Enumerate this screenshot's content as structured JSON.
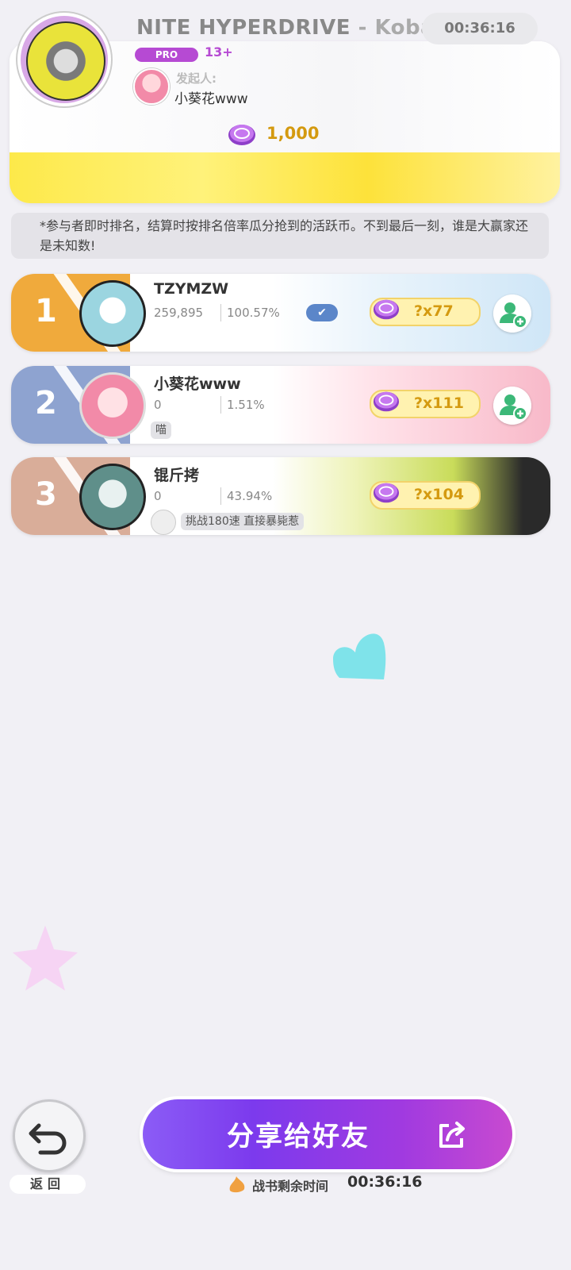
{
  "song": {
    "title": "NITE HYPERDRIVE",
    "artist": "Kobary",
    "separator": " - ",
    "timer": "00:36:16",
    "difficulty": "PRO",
    "level": "13+",
    "host_label": "发起人:",
    "host_name": "小葵花www",
    "prize": "1,000"
  },
  "notice": "*参与者即时排名，结算时按排名倍率瓜分抢到的活跃币。不到最后一刻，谁是大赢家还是未知数!",
  "players": [
    {
      "rank": "1",
      "name": "TZYMZW",
      "score": "259,895",
      "accuracy": "100.57%",
      "reward": "?x77",
      "tag": "",
      "color": "#f0aa3c"
    },
    {
      "rank": "2",
      "name": "小葵花www",
      "score": "0",
      "accuracy": "1.51%",
      "reward": "?x111",
      "tag": "喵",
      "color": "#8ea3d0"
    },
    {
      "rank": "3",
      "name": "锟斤拷",
      "score": "0",
      "accuracy": "43.94%",
      "reward": "?x104",
      "tag": "挑战180速 直接暴毙惹",
      "color": "#d9ad99"
    }
  ],
  "footer": {
    "back_label": "返回",
    "share_label": "分享给好友",
    "remaining_label": "战书剩余时间",
    "remaining_time": "00:36:16"
  },
  "colors": {
    "accent_purple": "#b64ad3",
    "coin_gold": "#d49a10",
    "share_start": "#8b5cf6",
    "share_end": "#c84ad0",
    "add_friend_green": "#3cb878"
  },
  "icons": [
    "album-jacket",
    "coin-icon",
    "check-icon",
    "add-friend-icon",
    "back-icon",
    "share-icon",
    "flame-icon",
    "heart-decoration",
    "star-decoration"
  ]
}
